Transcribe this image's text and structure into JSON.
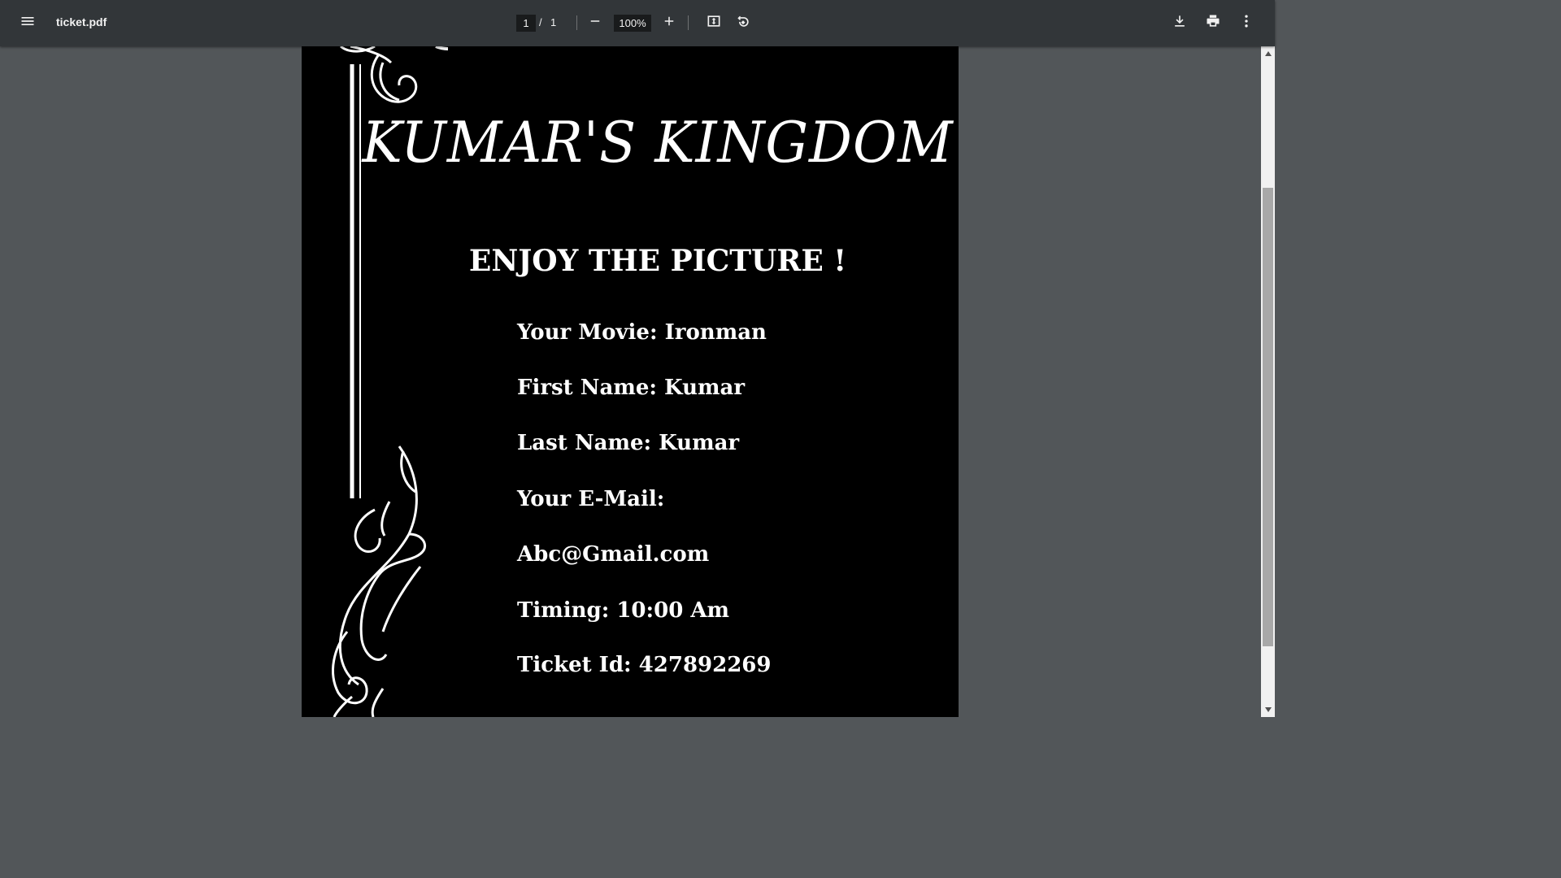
{
  "toolbar": {
    "file_name": "ticket.pdf",
    "current_page": "1",
    "page_separator": "/",
    "total_pages": "1",
    "zoom": "100%",
    "icons": {
      "menu": "menu-icon",
      "zoom_out": "minus-icon",
      "zoom_in": "plus-icon",
      "fit": "fit-page-icon",
      "rotate": "rotate-icon",
      "download": "download-icon",
      "print": "print-icon",
      "more": "more-vert-icon"
    }
  },
  "ticket": {
    "brand": "KUMAR'S KINGDOM",
    "headline": "ENJOY THE PICTURE !",
    "movie": "Your Movie: Ironman",
    "first_name": "First Name: Kumar",
    "last_name": "Last Name: Kumar",
    "email_label": "Your E-Mail:",
    "email": "Abc@Gmail.com",
    "timing": "Timing: 10:00 Am",
    "ticket_id": "Ticket Id: 427892269"
  },
  "colors": {
    "toolbar_bg": "#323639",
    "viewer_bg": "#525659",
    "page_bg": "#000000",
    "text": "#ffffff"
  }
}
